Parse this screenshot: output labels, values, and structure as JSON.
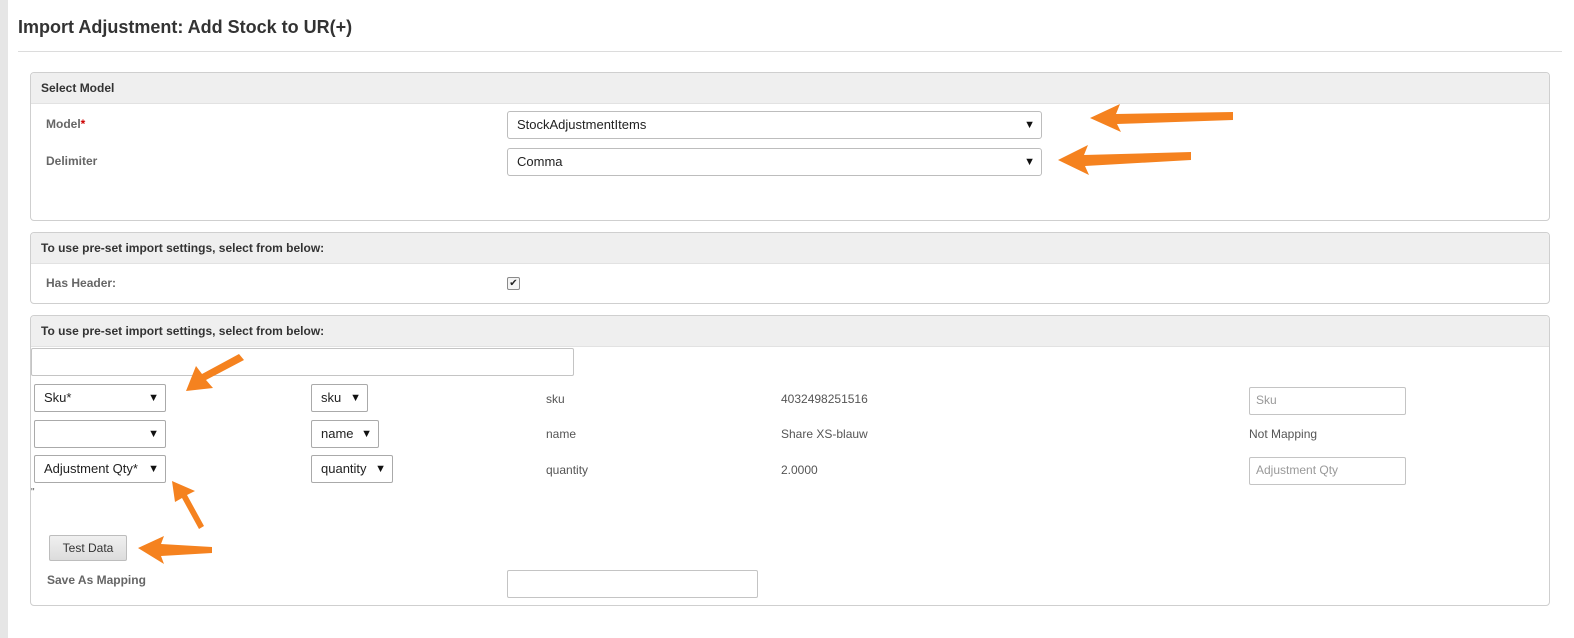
{
  "page": {
    "title": "Import Adjustment: Add Stock to UR(+)"
  },
  "select_model": {
    "header": "Select Model",
    "model_label": "Model",
    "model_required": "*",
    "model_value": "StockAdjustmentItems",
    "delimiter_label": "Delimiter",
    "delimiter_value": "Comma"
  },
  "preset_settings": {
    "header": "To use pre-set import settings, select from below:",
    "has_header_label": "Has Header:",
    "has_header_checked": true
  },
  "mapping": {
    "header": "To use pre-set import settings, select from below:",
    "filter_value": "",
    "rows": [
      {
        "field": "Sku*",
        "column": "sku",
        "source_name": "sku",
        "sample": "4032498251516",
        "target_placeholder": "Sku",
        "target_text": ""
      },
      {
        "field": "",
        "column": "name",
        "source_name": "name",
        "sample": "Share XS-blauw",
        "target_placeholder": "",
        "target_text": "Not Mapping"
      },
      {
        "field": "Adjustment Qty*",
        "column": "quantity",
        "source_name": "quantity",
        "sample": "2.0000",
        "target_placeholder": "Adjustment Qty",
        "target_text": ""
      }
    ],
    "stray_mark": "\"",
    "test_button": "Test Data",
    "save_mapping_label": "Save As Mapping",
    "save_mapping_value": ""
  },
  "icons": {
    "dropdown": "caret-down-icon",
    "annotation": "orange-arrow-icon",
    "check": "checkmark-icon"
  },
  "colors": {
    "annotation_arrow": "#f5821f",
    "required": "#cc0000",
    "panel_header": "#efefef"
  }
}
